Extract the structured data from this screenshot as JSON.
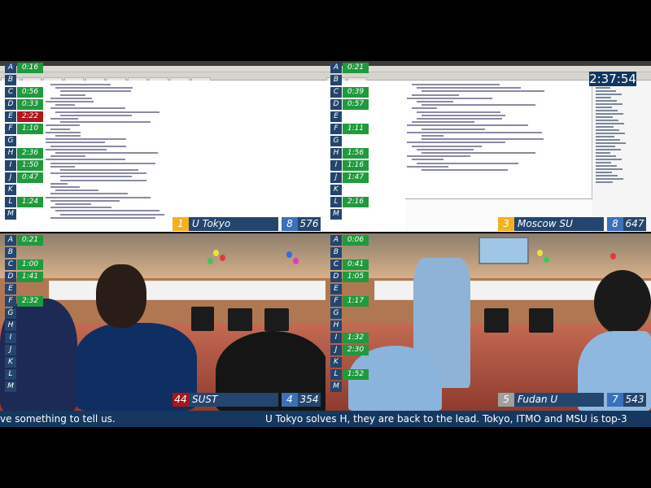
{
  "clock": "2:37:54",
  "ticker": {
    "left_text": "ve something to tell us.",
    "right_text": "U Tokyo solves H, they are back to the lead. Tokyo, ITMO and MSU is top-3"
  },
  "panels": [
    {
      "team": {
        "rank": "1",
        "name": "U Tokyo",
        "solved": "8",
        "penalty": "576",
        "rank_color": "gold"
      },
      "problems": [
        {
          "letter": "A",
          "time": "0:16",
          "state": "solved"
        },
        {
          "letter": "B",
          "time": "",
          "state": "none"
        },
        {
          "letter": "C",
          "time": "0:56",
          "state": "solved"
        },
        {
          "letter": "D",
          "time": "0:33",
          "state": "solved"
        },
        {
          "letter": "E",
          "time": "2:22",
          "state": "first"
        },
        {
          "letter": "F",
          "time": "1:10",
          "state": "solved"
        },
        {
          "letter": "G",
          "time": "",
          "state": "none"
        },
        {
          "letter": "H",
          "time": "2:36",
          "state": "solved"
        },
        {
          "letter": "I",
          "time": "1:50",
          "state": "solved"
        },
        {
          "letter": "J",
          "time": "0:47",
          "state": "solved"
        },
        {
          "letter": "K",
          "time": "",
          "state": "none"
        },
        {
          "letter": "L",
          "time": "1:24",
          "state": "solved"
        },
        {
          "letter": "M",
          "time": "",
          "state": "none"
        }
      ]
    },
    {
      "team": {
        "rank": "3",
        "name": "Moscow SU",
        "solved": "8",
        "penalty": "647",
        "rank_color": "gold"
      },
      "problems": [
        {
          "letter": "A",
          "time": "0:21",
          "state": "solved"
        },
        {
          "letter": "B",
          "time": "",
          "state": "none"
        },
        {
          "letter": "C",
          "time": "0:39",
          "state": "solved"
        },
        {
          "letter": "D",
          "time": "0:57",
          "state": "solved"
        },
        {
          "letter": "E",
          "time": "",
          "state": "none"
        },
        {
          "letter": "F",
          "time": "1:11",
          "state": "solved"
        },
        {
          "letter": "G",
          "time": "",
          "state": "none"
        },
        {
          "letter": "H",
          "time": "1:56",
          "state": "solved"
        },
        {
          "letter": "I",
          "time": "1:16",
          "state": "solved"
        },
        {
          "letter": "J",
          "time": "1:47",
          "state": "solved"
        },
        {
          "letter": "K",
          "time": "",
          "state": "none"
        },
        {
          "letter": "L",
          "time": "2:16",
          "state": "solved"
        },
        {
          "letter": "M",
          "time": "",
          "state": "none"
        }
      ]
    },
    {
      "team": {
        "rank": "44",
        "name": "SUST",
        "solved": "4",
        "penalty": "354",
        "rank_color": "red"
      },
      "problems": [
        {
          "letter": "A",
          "time": "0:21",
          "state": "solved"
        },
        {
          "letter": "B",
          "time": "",
          "state": "none"
        },
        {
          "letter": "C",
          "time": "1:00",
          "state": "solved"
        },
        {
          "letter": "D",
          "time": "1:41",
          "state": "solved"
        },
        {
          "letter": "E",
          "time": "",
          "state": "none"
        },
        {
          "letter": "F",
          "time": "2:32",
          "state": "solved"
        },
        {
          "letter": "G",
          "time": "",
          "state": "none"
        },
        {
          "letter": "H",
          "time": "",
          "state": "none"
        },
        {
          "letter": "I",
          "time": "",
          "state": "none"
        },
        {
          "letter": "J",
          "time": "",
          "state": "none"
        },
        {
          "letter": "K",
          "time": "",
          "state": "none"
        },
        {
          "letter": "L",
          "time": "",
          "state": "none"
        },
        {
          "letter": "M",
          "time": "",
          "state": "none"
        }
      ]
    },
    {
      "team": {
        "rank": "5",
        "name": "Fudan U",
        "solved": "7",
        "penalty": "543",
        "rank_color": "silver"
      },
      "problems": [
        {
          "letter": "A",
          "time": "0:06",
          "state": "solved"
        },
        {
          "letter": "B",
          "time": "",
          "state": "none"
        },
        {
          "letter": "C",
          "time": "0:41",
          "state": "solved"
        },
        {
          "letter": "D",
          "time": "1:05",
          "state": "solved"
        },
        {
          "letter": "E",
          "time": "",
          "state": "none"
        },
        {
          "letter": "F",
          "time": "1:17",
          "state": "solved"
        },
        {
          "letter": "G",
          "time": "",
          "state": "none"
        },
        {
          "letter": "H",
          "time": "",
          "state": "none"
        },
        {
          "letter": "I",
          "time": "1:32",
          "state": "solved"
        },
        {
          "letter": "J",
          "time": "2:30",
          "state": "solved"
        },
        {
          "letter": "K",
          "time": "",
          "state": "none"
        },
        {
          "letter": "L",
          "time": "1:52",
          "state": "solved"
        },
        {
          "letter": "M",
          "time": "",
          "state": "none"
        }
      ]
    }
  ],
  "colors": {
    "solved": "#1f9a3c",
    "first_solve": "#b0161c",
    "navy": "#24456e",
    "gold_rank": "#f2b21f"
  }
}
